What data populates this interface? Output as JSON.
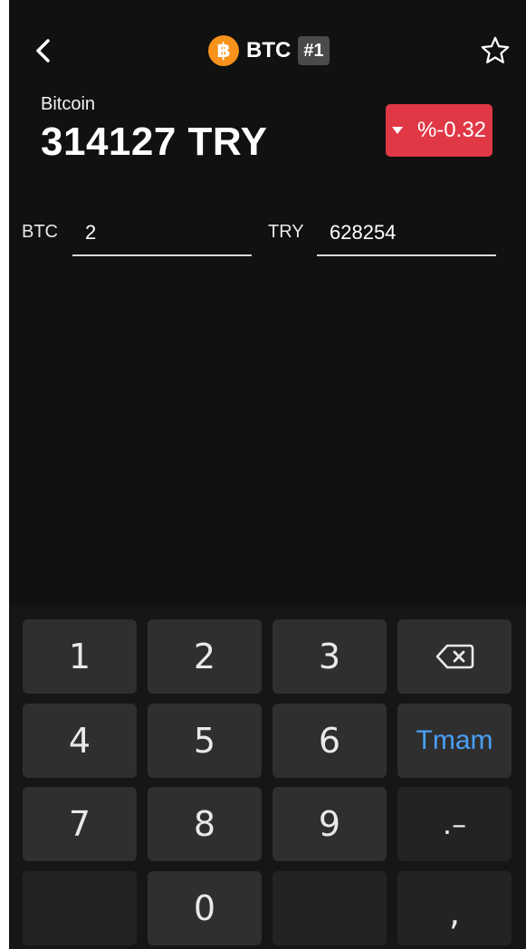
{
  "header": {
    "coin_logo_symbol": "฿",
    "coin_symbol": "BTC",
    "rank": "#1",
    "icons": [
      "back-arrow-icon",
      "bitcoin-logo-icon",
      "star-icon"
    ]
  },
  "price": {
    "coin_name": "Bitcoin",
    "value": "314127 TRY",
    "change": "%-0.32",
    "change_color": "#e03845"
  },
  "converter": {
    "left_currency": "BTC",
    "left_value": "2",
    "right_currency": "TRY",
    "right_value": "628254"
  },
  "keypad": {
    "keys": [
      "1",
      "2",
      "3",
      "",
      "4",
      "5",
      "6",
      "Tmam",
      "7",
      "8",
      "9",
      ".–",
      "",
      "0",
      "",
      ","
    ],
    "backspace_icon": "backspace-icon",
    "action_color": "#4a9ff5"
  }
}
